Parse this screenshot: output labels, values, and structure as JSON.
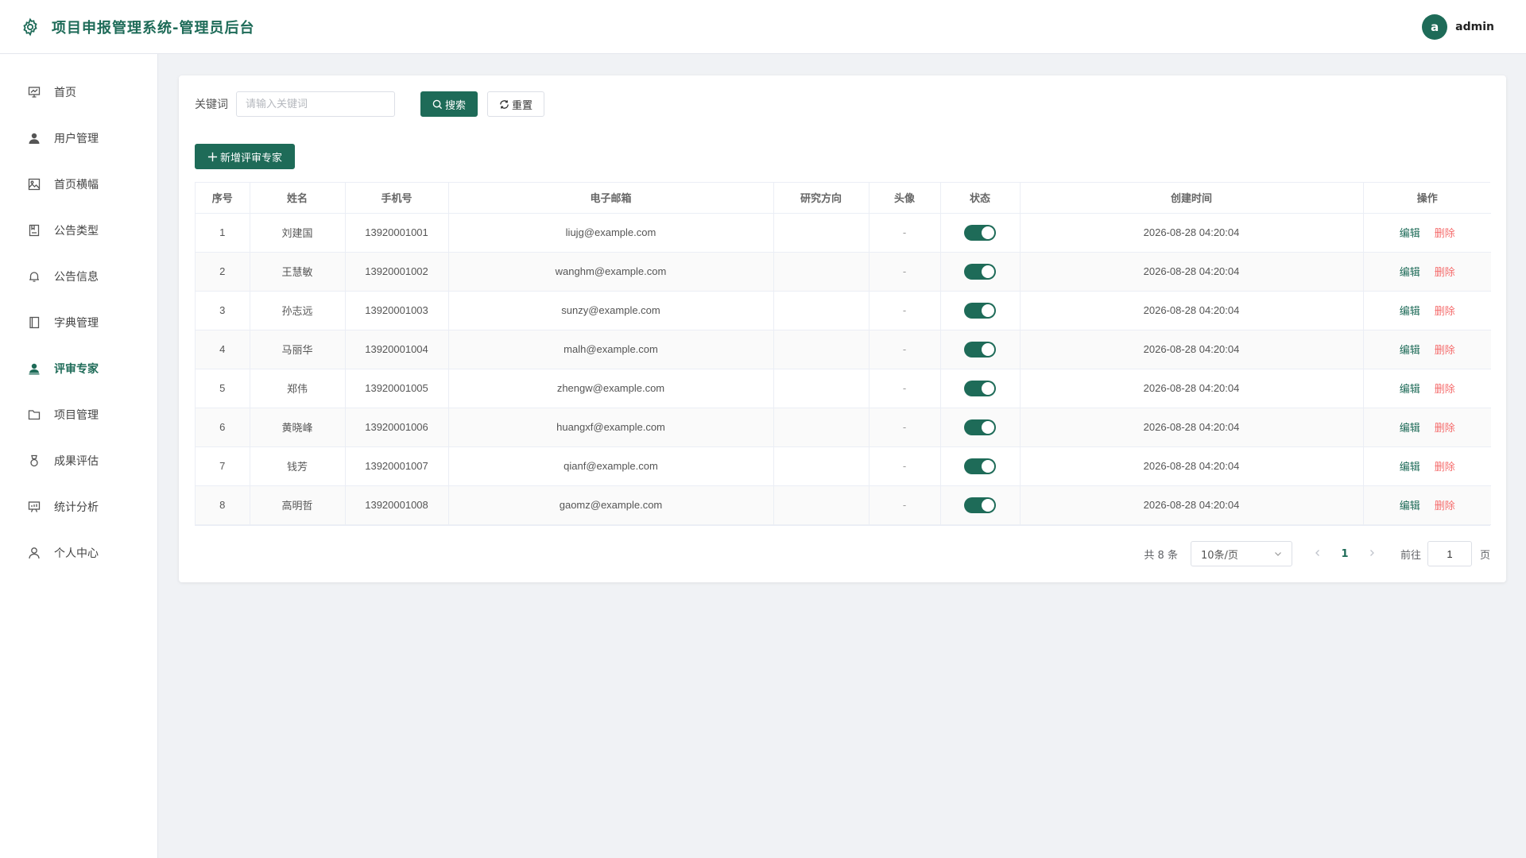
{
  "header": {
    "title": "项目申报管理系统-管理员后台",
    "avatar_letter": "a",
    "username": "admin"
  },
  "sidebar": {
    "items": [
      {
        "label": "首页",
        "icon": "presentation-icon",
        "active": false
      },
      {
        "label": "用户管理",
        "icon": "user-icon",
        "active": false
      },
      {
        "label": "首页横幅",
        "icon": "picture-icon",
        "active": false
      },
      {
        "label": "公告类型",
        "icon": "notebook-icon",
        "active": false
      },
      {
        "label": "公告信息",
        "icon": "bell-icon",
        "active": false
      },
      {
        "label": "字典管理",
        "icon": "book-icon",
        "active": false
      },
      {
        "label": "评审专家",
        "icon": "avatar-icon",
        "active": true
      },
      {
        "label": "项目管理",
        "icon": "folder-icon",
        "active": false
      },
      {
        "label": "成果评估",
        "icon": "medal-icon",
        "active": false
      },
      {
        "label": "统计分析",
        "icon": "data-board-icon",
        "active": false
      },
      {
        "label": "个人中心",
        "icon": "user-outline-icon",
        "active": false
      }
    ]
  },
  "search": {
    "label": "关键词",
    "placeholder": "请输入关键词",
    "value": "",
    "search_label": "搜索",
    "reset_label": "重置"
  },
  "toolbar": {
    "add_label": "新增评审专家"
  },
  "table": {
    "columns": [
      "序号",
      "姓名",
      "手机号",
      "电子邮箱",
      "研究方向",
      "头像",
      "状态",
      "创建时间",
      "操作"
    ],
    "edit_label": "编辑",
    "delete_label": "删除",
    "rows": [
      {
        "index": "1",
        "name": "刘建国",
        "phone": "13920001001",
        "email": "liujg@example.com",
        "research": "",
        "avatar": "-",
        "enabled": true,
        "created": "2026-08-28 04:20:04"
      },
      {
        "index": "2",
        "name": "王慧敏",
        "phone": "13920001002",
        "email": "wanghm@example.com",
        "research": "",
        "avatar": "-",
        "enabled": true,
        "created": "2026-08-28 04:20:04"
      },
      {
        "index": "3",
        "name": "孙志远",
        "phone": "13920001003",
        "email": "sunzy@example.com",
        "research": "",
        "avatar": "-",
        "enabled": true,
        "created": "2026-08-28 04:20:04"
      },
      {
        "index": "4",
        "name": "马丽华",
        "phone": "13920001004",
        "email": "malh@example.com",
        "research": "",
        "avatar": "-",
        "enabled": true,
        "created": "2026-08-28 04:20:04"
      },
      {
        "index": "5",
        "name": "郑伟",
        "phone": "13920001005",
        "email": "zhengw@example.com",
        "research": "",
        "avatar": "-",
        "enabled": true,
        "created": "2026-08-28 04:20:04"
      },
      {
        "index": "6",
        "name": "黄晓峰",
        "phone": "13920001006",
        "email": "huangxf@example.com",
        "research": "",
        "avatar": "-",
        "enabled": true,
        "created": "2026-08-28 04:20:04"
      },
      {
        "index": "7",
        "name": "钱芳",
        "phone": "13920001007",
        "email": "qianf@example.com",
        "research": "",
        "avatar": "-",
        "enabled": true,
        "created": "2026-08-28 04:20:04"
      },
      {
        "index": "8",
        "name": "高明哲",
        "phone": "13920001008",
        "email": "gaomz@example.com",
        "research": "",
        "avatar": "-",
        "enabled": true,
        "created": "2026-08-28 04:20:04"
      }
    ]
  },
  "pagination": {
    "total_text": "共 8 条",
    "page_size": "10条/页",
    "current_page": "1",
    "goto_label": "前往",
    "goto_value": "1",
    "goto_unit": "页"
  },
  "colors": {
    "primary": "#1e6b58",
    "danger": "#f56c6c"
  }
}
